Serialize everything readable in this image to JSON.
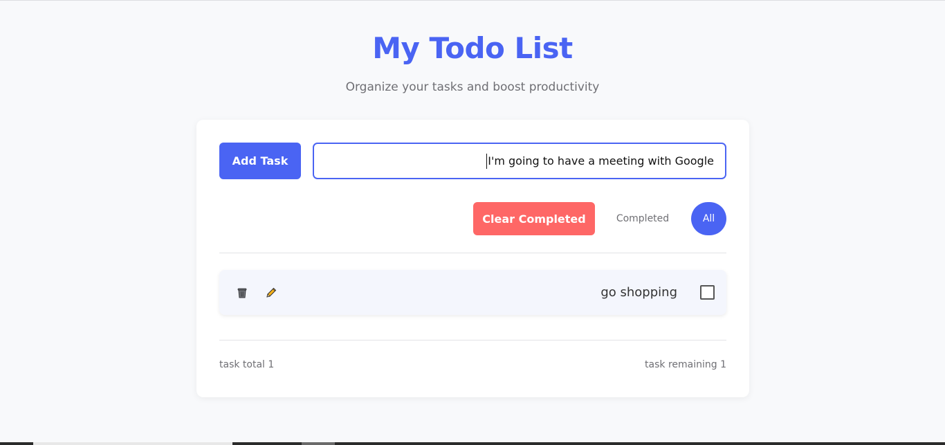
{
  "header": {
    "title": "My Todo List",
    "subtitle": "Organize your tasks and boost productivity"
  },
  "composer": {
    "add_button_label": "Add Task",
    "input_value": "I'm going to have a meeting with Google"
  },
  "filters": {
    "clear_completed_label": "Clear Completed",
    "completed_label": "Completed",
    "all_label": "All",
    "active_filter": "All"
  },
  "tasks": [
    {
      "text": "go shopping",
      "completed": false,
      "icons": [
        "trash-icon",
        "pencil-icon"
      ]
    }
  ],
  "footer": {
    "total_label": "task total 1",
    "remaining_label": "task remaining 1"
  },
  "colors": {
    "accent": "#4a64f3",
    "danger": "#fe6766",
    "background": "#f8f9fb"
  }
}
